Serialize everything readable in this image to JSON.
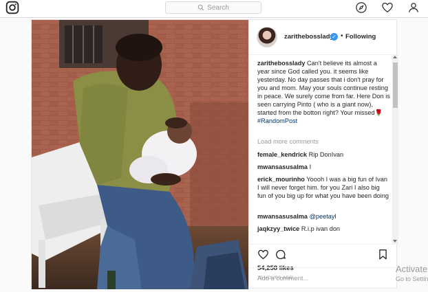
{
  "nav": {
    "search_placeholder": "Search",
    "icons": [
      "instagram-logo-icon",
      "search-icon",
      "explore-icon",
      "activity-heart-icon",
      "profile-icon"
    ]
  },
  "post": {
    "username": "zarithebosslady",
    "following_label": "Following",
    "caption": "Can't believe its almost a year since God called you. it seems like yesterday. No day passes that i don't pray for you and mom. May your souls continue resting in peace. We surely come from far. Here Don is seen carrying Pinto ( who is a giant now), started from the botton right? Your missed🌹",
    "hashtag": "#RandomPost",
    "load_more": "Load more comments",
    "comments": [
      {
        "user": "female_kendrick",
        "text": "Rip DonIvan"
      },
      {
        "user": "mwansasusalma",
        "text": "I"
      },
      {
        "user": "erick_mourinho",
        "text": "Yoooh I was a big fun of Ivan I will never forget him. for you Zari I also big fun of you big up for what you have been doing"
      },
      {
        "user": "mwansasusalma",
        "text": "@peetayl"
      },
      {
        "user": "jaqkzyy_twice",
        "text": "R.i.p ivan don"
      }
    ],
    "likes": "54,258 likes",
    "time": "10 HOURS AGO",
    "add_comment_placeholder": "Add a comment..."
  },
  "watermark": {
    "title": "Activate",
    "subtitle": "Go to Settin"
  },
  "colors": {
    "link": "#003569",
    "verified": "#3897f0",
    "muted": "#999999",
    "border": "#dbdbdb"
  }
}
